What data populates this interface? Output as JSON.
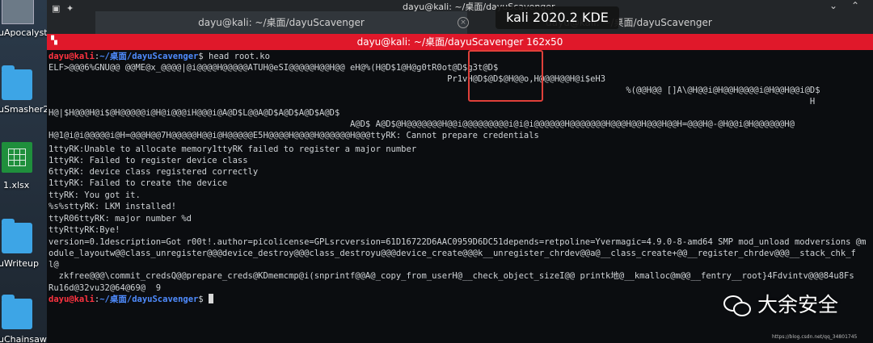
{
  "desktop": {
    "icons": [
      {
        "label": "uApocalyst",
        "kind": "image-thumbnail"
      },
      {
        "label": "uSmasher2",
        "kind": "folder-icon"
      },
      {
        "label": "1.xlsx",
        "kind": "spreadsheet-icon"
      },
      {
        "label": "uWriteup",
        "kind": "folder-icon"
      },
      {
        "label": "uChainsaw",
        "kind": "folder-icon"
      }
    ]
  },
  "tabbar": {
    "top_title": "dayu@kali: ~/桌面/dayuScavenger",
    "tab1_label": "dayu@kali: ~/桌面/dayuScavenger",
    "tab2_label": "dayu@kali: ~/桌面/dayuScavenger",
    "overlay_label": "kali 2020.2 KDE"
  },
  "terminal": {
    "title": "dayu@kali: ~/桌面/dayuScavenger 162x50",
    "prompt_user": "dayu@kali",
    "prompt_sep": ":",
    "prompt_path": "~/桌面/dayuScavenger",
    "prompt_end": "$",
    "command": " head root.ko",
    "lines": [
      "ELF>@@@6%GNU@@ @@ME@x_@@@@|@i@@@@H@@@@@ATUH@eSI@@@@@H@@H@@ eH@%(H@D$1@H@g0tR0ot@D$g3t@D$",
      "                                                                              Pr1vH@D$@D$@H@@o,H@@@H@@H@i$eH3",
      "                                                                                                                 %(@@H@@ []A\\@H@@i@H@@H@@@@i@H@@H@@i@D$",
      "                                                                                                                                                     H",
      "H@|$H@@@H@i$@H@@@@@i@H@i@@@iH@@@i@A@D$L@@A@D$A@D$A@D$A@D$",
      "                                                           A@D$ A@D$@H@@@@@@@H@@i@@@@@@@@@i@i@i@@@@@@H@@@@@@@H@@@H@@H@@@H@@H=@@@H@-@H@@i@H@@@@@@H@",
      "H@1@i@i@@@@@i@H=@@@H@@7H@@@@@H@@i@H@@@@@E5H@@@@H@@@@H@@@@@@H@@@ttyRK: Cannot prepare credentials",
      "1ttyRK:Unable to allocate memory1ttyRK failed to register a major number",
      "1ttyRK: Failed to register device class",
      "6ttyRK: device class registered correctly",
      "1ttyRK: Failed to create the device",
      "ttyRK: You got it.",
      "%s%sttyRK: LKM installed!",
      "ttyR06ttyRK: major number %d",
      "ttyRttyRK:Bye!",
      "version=0.1description=Got r00t!.author=picolicense=GPLsrcversion=61D16722D6AAC0959D6DC51depends=retpoline=Yvermagic=4.9.0-8-amd64 SMP mod_unload modversions @m",
      "odule_layoutw@@class_unregister@@@device_destroy@@@class_destroyu@@@device_create@@@k__unregister_chrdev@@a@__class_create+@@__register_chrdev@@@__stack_chk_f",
      "l@",
      "  zkfree@@@\\commit_credsQ@@prepare_creds@KDmemcmp@i(snprintf@@A@_copy_from_userH@__check_object_sizeI@@ printk地@__kmalloc@m@@__fentry__root}4Fdvintv@@@84u8Fs",
      "Ru16d@32vu32@64@69@  9"
    ]
  },
  "watermark": {
    "text": "大余安全",
    "credit": "https://blog.csdn.net/qq_34801745"
  }
}
